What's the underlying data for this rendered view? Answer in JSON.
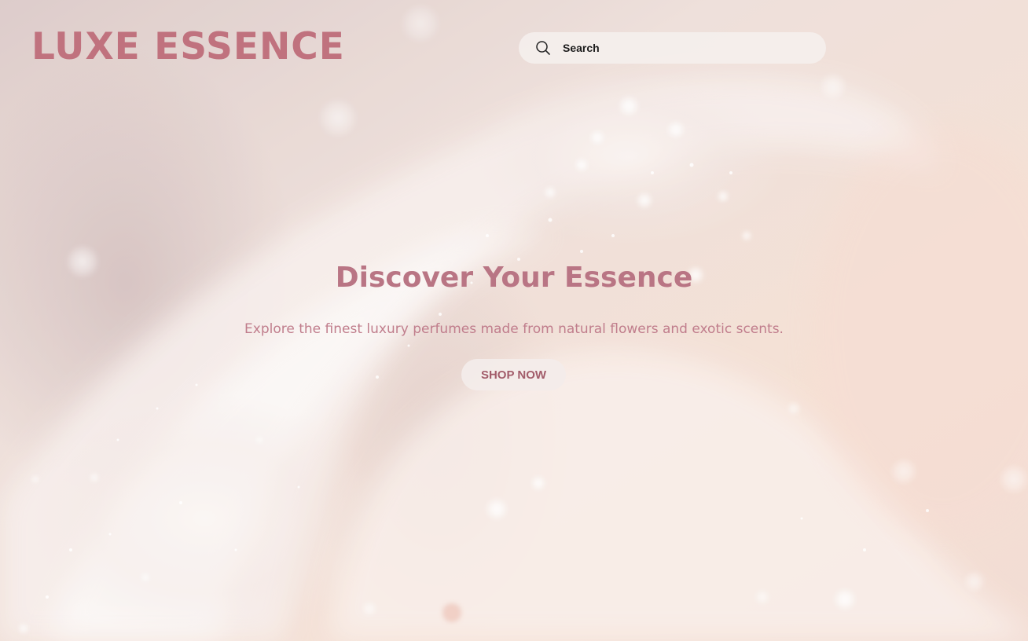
{
  "brand": {
    "logo_text": "LUXE ESSENCE",
    "accent_color": "#c0727e"
  },
  "search": {
    "placeholder": "Search",
    "value": "",
    "icon": "search-icon"
  },
  "hero": {
    "title": "Discover Your Essence",
    "subtitle": "Explore the finest luxury perfumes made from natural flowers and exotic scents.",
    "cta_label": "SHOP NOW",
    "background": "sparkling-silk-fabric-image"
  }
}
